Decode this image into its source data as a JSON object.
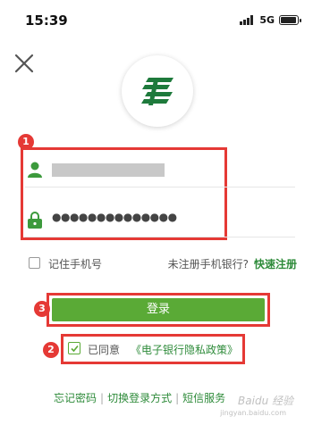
{
  "status_bar": {
    "time": "15:39",
    "network": "5G",
    "battery_level": 0.85
  },
  "login_form": {
    "password_masked": "●●●●●●●●●●●●●●",
    "remember_label": "记住手机号",
    "unregistered_text": "未注册手机银行?",
    "quick_register": "快速注册",
    "login_button": "登录"
  },
  "agreement": {
    "prefix": "已同意",
    "policy": "《电子银行隐私政策》",
    "checked": true
  },
  "bottom_links": {
    "forgot_password": "忘记密码",
    "switch_login": "切换登录方式",
    "sms_service": "短信服务"
  },
  "annotations": {
    "badge1": "1",
    "badge2": "2",
    "badge3": "3",
    "color": "#e53935"
  },
  "watermark": {
    "text": "Baidu 经验",
    "sub": "jingyan.baidu.com"
  },
  "colors": {
    "brand_green": "#2e8b3a",
    "button_green": "#5aaa36"
  },
  "icons": [
    "close-icon",
    "postal-logo-icon",
    "user-icon",
    "lock-icon"
  ]
}
